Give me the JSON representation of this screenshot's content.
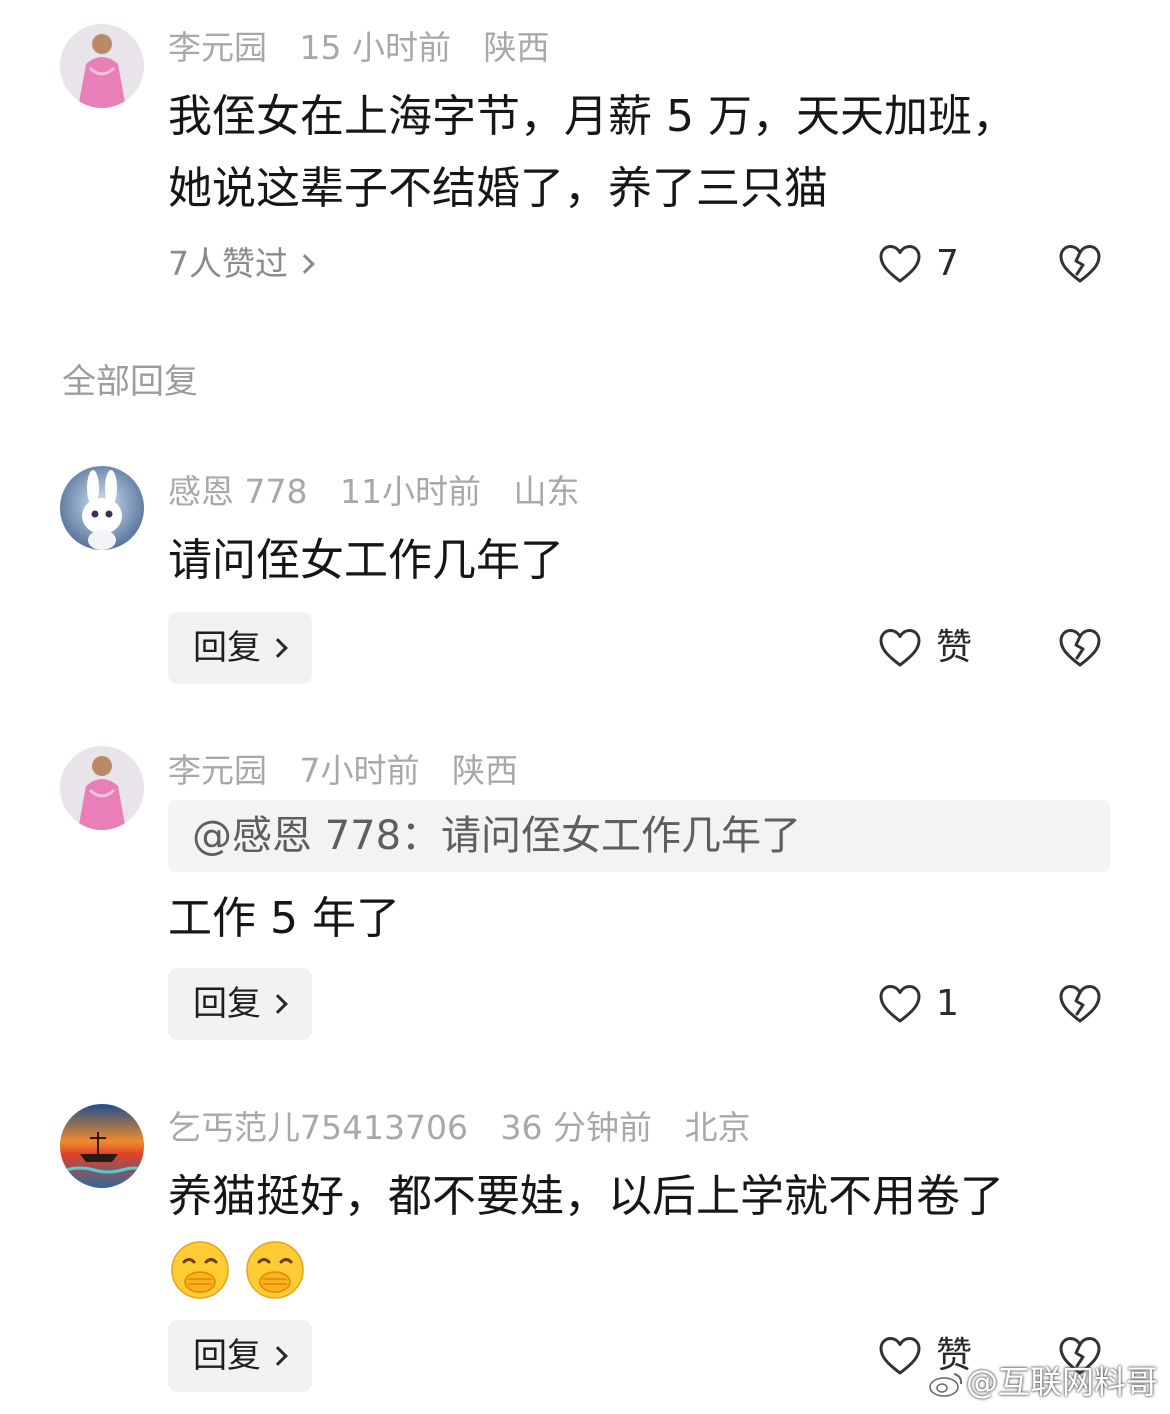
{
  "comment": {
    "username": "李元园",
    "time": "15 小时前",
    "location": "陕西",
    "text_line1": "我侄女在上海字节，月薪 5 万，天天加班，",
    "text_line2": "她说这辈子不结婚了，养了三只猫",
    "likers": "7人赞过",
    "like_count": "7"
  },
  "section_title": "全部回复",
  "replies": [
    {
      "username": "感恩 778",
      "time": "11小时前",
      "location": "山东",
      "text": "请问侄女工作几年了",
      "reply_label": "回复",
      "like_label": "赞"
    },
    {
      "username": "李元园",
      "time": "7小时前",
      "location": "陕西",
      "quote": "@感恩 778：请问侄女工作几年了",
      "text": "工作 5 年了",
      "reply_label": "回复",
      "like_label": "1"
    },
    {
      "username": "乞丐范儿75413706",
      "time": "36 分钟前",
      "location": "北京",
      "text": "养猫挺好，都不要娃，以后上学就不用卷了",
      "emojis": [
        "hand-over-mouth-emoji",
        "hand-over-mouth-emoji"
      ],
      "reply_label": "回复",
      "like_label": "赞"
    }
  ],
  "watermark": "@互联网料哥",
  "icons": {
    "like": "heart-outline-icon",
    "dislike": "broken-heart-icon",
    "chevron": "chevron-right-icon"
  }
}
